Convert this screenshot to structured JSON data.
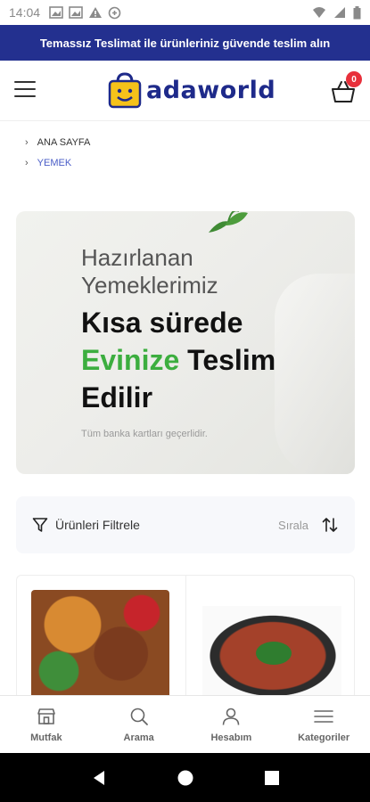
{
  "status_bar": {
    "time": "14:04"
  },
  "promo": {
    "text": "Temassız Teslimat ile ürünleriniz güvende teslim alın"
  },
  "header": {
    "logo_text": "adaworld",
    "cart_count": "0"
  },
  "breadcrumb": [
    {
      "label": "ANA SAYFA"
    },
    {
      "label": "YEMEK"
    }
  ],
  "hero": {
    "subtitle_line1": "Hazırlanan",
    "subtitle_line2": "Yemeklerimiz",
    "title_line1": "Kısa sürede",
    "title_green": "Evinize",
    "title_line2_rest": " Teslim",
    "title_line3": "Edilir",
    "note": "Tüm banka kartları geçerlidir."
  },
  "filter_bar": {
    "filter_label": "Ürünleri Filtrele",
    "sort_label": "Sırala"
  },
  "bottom_nav": [
    {
      "label": "Mutfak",
      "icon": "store-icon"
    },
    {
      "label": "Arama",
      "icon": "search-icon"
    },
    {
      "label": "Hesabım",
      "icon": "user-icon"
    },
    {
      "label": "Kategoriler",
      "icon": "menu-icon"
    }
  ],
  "colors": {
    "banner": "#23308f",
    "accent_green": "#3cae3f",
    "badge": "#e8303b",
    "logo": "#1e2a8a"
  }
}
